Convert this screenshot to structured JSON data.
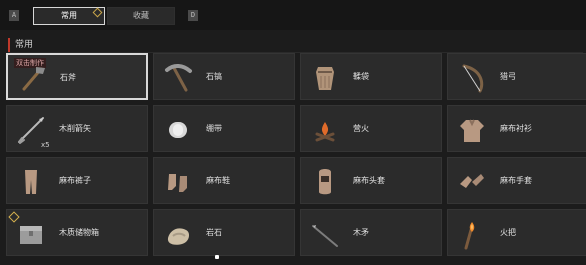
{
  "top": {
    "left_key": "A",
    "right_key": "D",
    "tabs": [
      {
        "label": "常用"
      },
      {
        "label": "收藏"
      }
    ]
  },
  "section": {
    "title": "常用"
  },
  "items": [
    {
      "label": "石斧",
      "tag": "双击制作"
    },
    {
      "label": "石镐"
    },
    {
      "label": "鞣袋"
    },
    {
      "label": "猎弓"
    },
    {
      "label": "木削箭矢",
      "qty": "x5"
    },
    {
      "label": "绷带"
    },
    {
      "label": "营火"
    },
    {
      "label": "麻布衬衫"
    },
    {
      "label": "麻布裤子"
    },
    {
      "label": "麻布鞋"
    },
    {
      "label": "麻布头套"
    },
    {
      "label": "麻布手套"
    },
    {
      "label": "木质储物箱"
    },
    {
      "label": "岩石"
    },
    {
      "label": "木矛"
    },
    {
      "label": "火把"
    }
  ]
}
